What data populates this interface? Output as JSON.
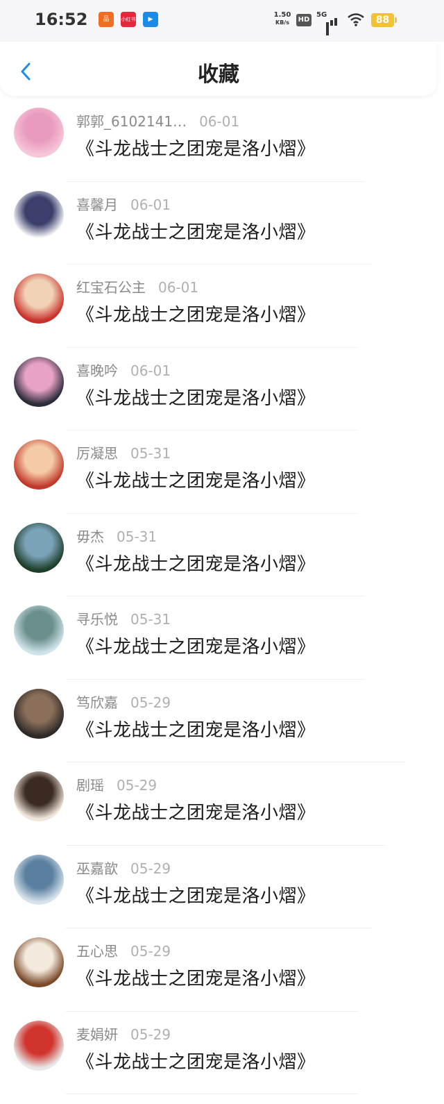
{
  "status_bar": {
    "time": "16:52",
    "net_speed_value": "1.50",
    "net_speed_unit": "KB/s",
    "hd": "HD",
    "network": "5G",
    "battery": "88",
    "app_icons": [
      {
        "name": "app-icon-orange",
        "color": "#f26d21",
        "text": "品"
      },
      {
        "name": "app-icon-red",
        "color": "#e8273d",
        "text": "小红书"
      },
      {
        "name": "app-icon-blue",
        "color": "#1a8ce8",
        "text": "▶"
      }
    ]
  },
  "navbar": {
    "back_icon": "chevron-left-icon",
    "title": "收藏",
    "accent": "#1a8ce8"
  },
  "favorites": [
    {
      "user": "郭郭_6102141…",
      "date": "06-01",
      "title": "《斗龙战士之团宠是洛小熠》",
      "avatar_colors": [
        "#f7c6d9",
        "#e89bbd"
      ]
    },
    {
      "user": "喜馨月",
      "date": "06-01",
      "title": "《斗龙战士之团宠是洛小熠》",
      "avatar_colors": [
        "#ffffff",
        "#3a3f6b"
      ]
    },
    {
      "user": "红宝石公主",
      "date": "06-01",
      "title": "《斗龙战士之团宠是洛小熠》",
      "avatar_colors": [
        "#c9302c",
        "#f2d2b6"
      ]
    },
    {
      "user": "喜晚吟",
      "date": "06-01",
      "title": "《斗龙战士之团宠是洛小熠》",
      "avatar_colors": [
        "#2b2b3a",
        "#e7a2c4"
      ]
    },
    {
      "user": "厉凝思",
      "date": "05-31",
      "title": "《斗龙战士之团宠是洛小熠》",
      "avatar_colors": [
        "#c0392b",
        "#f5cba7"
      ]
    },
    {
      "user": "毋杰",
      "date": "05-31",
      "title": "《斗龙战士之团宠是洛小熠》",
      "avatar_colors": [
        "#1e3d2a",
        "#7ba3b8"
      ]
    },
    {
      "user": "寻乐悦",
      "date": "05-31",
      "title": "《斗龙战士之团宠是洛小熠》",
      "avatar_colors": [
        "#cfe3ea",
        "#6b8f8a"
      ]
    },
    {
      "user": "笃欣嘉",
      "date": "05-29",
      "title": "《斗龙战士之团宠是洛小熠》",
      "avatar_colors": [
        "#2e2a28",
        "#8b6f5a"
      ]
    },
    {
      "user": "剧瑶",
      "date": "05-29",
      "title": "《斗龙战士之团宠是洛小熠》",
      "avatar_colors": [
        "#f0e6da",
        "#3b2a22"
      ]
    },
    {
      "user": "巫嘉歆",
      "date": "05-29",
      "title": "《斗龙战士之团宠是洛小熠》",
      "avatar_colors": [
        "#d6e2ea",
        "#5a7fa0"
      ]
    },
    {
      "user": "五心思",
      "date": "05-29",
      "title": "《斗龙战士之团宠是洛小熠》",
      "avatar_colors": [
        "#7a4a2a",
        "#f3e9dc"
      ]
    },
    {
      "user": "麦娟妍",
      "date": "05-29",
      "title": "《斗龙战士之团宠是洛小熠》",
      "avatar_colors": [
        "#e8e8e8",
        "#d0342c"
      ]
    }
  ]
}
